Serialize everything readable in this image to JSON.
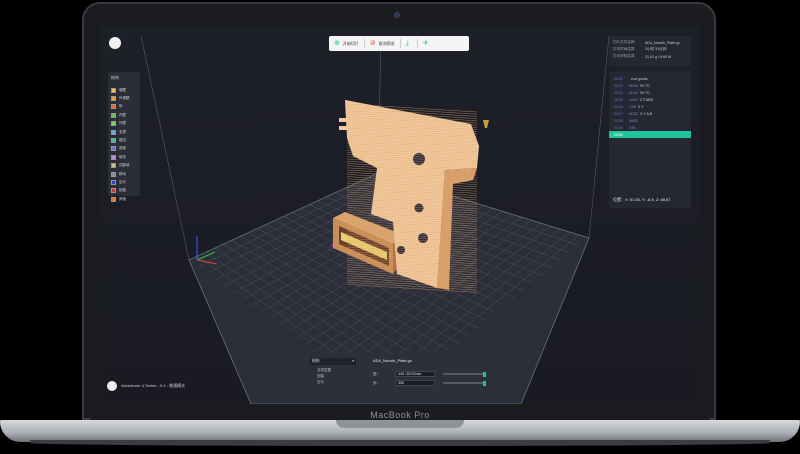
{
  "device": {
    "brand_label": "MacBook Pro"
  },
  "toolbar": {
    "items": [
      {
        "label": "开始切片",
        "icon": "play-circle-icon",
        "icon_glyph": "⊕",
        "color": "#1fc59a"
      },
      {
        "label": "取消预览",
        "icon": "cancel-icon",
        "icon_glyph": "⊘",
        "color": "#e0463c"
      },
      {
        "label": "",
        "icon": "download-icon",
        "icon_glyph": "⤓",
        "color": "#1fc59a"
      },
      {
        "label": "",
        "icon": "upload-printer-icon",
        "icon_glyph": "✈",
        "color": "#1fc59a"
      }
    ]
  },
  "legend": {
    "title": "结构",
    "items": [
      {
        "label": "墙壁",
        "color": "#f6c54a"
      },
      {
        "label": "外墙壁",
        "color": "#f09a38"
      },
      {
        "label": "桥",
        "color": "#e8662e"
      },
      {
        "label": "内壁",
        "color": "#67c14b"
      },
      {
        "label": "外壁",
        "color": "#7fd45a"
      },
      {
        "label": "支撑",
        "color": "#55aaf0"
      },
      {
        "label": "裙边",
        "color": "#3fb6a6"
      },
      {
        "label": "底部",
        "color": "#6a6dd1"
      },
      {
        "label": "填充",
        "color": "#b889e0"
      },
      {
        "label": "顶部填",
        "color": "#d2c28a"
      },
      {
        "label": "移动",
        "color": "#8a8a8a"
      },
      {
        "label": "空头",
        "color": "#2a3fbf"
      },
      {
        "label": "回抽",
        "color": "#c9352a"
      },
      {
        "label": "其他",
        "color": "#e67a22"
      }
    ]
  },
  "file_info": {
    "rows": [
      {
        "key": "切片文件名称",
        "value": "AD4_Nozzle_Plate.gx"
      },
      {
        "key": "打印时间估算",
        "value": "2小时 31分钟"
      },
      {
        "key": "打印材料估算",
        "value": "21.92 g / 6.69 M"
      }
    ]
  },
  "gcode": {
    "lines": [
      {
        "num": "78252",
        "cmd": "",
        "text": "end gcode"
      },
      {
        "num": "78253",
        "cmd": "M104",
        "text": "S0 T0"
      },
      {
        "num": "78254",
        "cmd": "M140",
        "text": "S0 T0"
      },
      {
        "num": "78255",
        "cmd": "G162",
        "text": "Z F1800"
      },
      {
        "num": "78256",
        "cmd": "G28",
        "text": "X Y"
      },
      {
        "num": "78257",
        "cmd": "M132",
        "text": "X Y A B"
      },
      {
        "num": "78258",
        "cmd": "M652",
        "text": ""
      },
      {
        "num": "78259",
        "cmd": "G91",
        "text": ""
      },
      {
        "num": "78260",
        "cmd": "",
        "text": ""
      }
    ],
    "position": "位置：X: 51.53, Y: -8.8, Z: 88.87"
  },
  "layer_panel": {
    "mode_select": "结构",
    "options": [
      "当前层模",
      "回抽",
      "空头"
    ],
    "file_name": "AD4_Nozzle_Plate.gx",
    "rows": [
      {
        "label": "层：",
        "value": "440 / 80.57mm",
        "fill": 1.0
      },
      {
        "label": "步：",
        "value": "306",
        "fill": 1.0
      }
    ]
  },
  "status": {
    "printer": "Adventurer 4 Series - 0.4 - 普通模式"
  }
}
